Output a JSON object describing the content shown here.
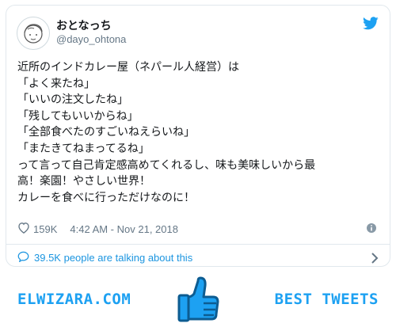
{
  "user": {
    "display_name": "おとなっち",
    "handle": "@dayo_ohtona"
  },
  "tweet": {
    "lines": [
      "近所のインドカレー屋（ネパール人経営）は",
      "「よく来たね」",
      "「いいの注文したね」",
      "「残してもいいからね」",
      "「全部食べたのすごいねえらいね」",
      "「またきてねまってるね」",
      "って言って自己肯定感高めてくれるし、味も美味しいから最",
      "高！楽園！やさしい世界！",
      "カレーを食べに行っただけなのに！"
    ]
  },
  "meta": {
    "likes": "159K",
    "timestamp": "4:42 AM - Nov 21, 2018"
  },
  "conversation": {
    "label": "39.5K people are talking about this"
  },
  "banner": {
    "left_text": "ELWIZARA.COM",
    "right_text": "BEST TWEETS"
  },
  "colors": {
    "accent": "#1da1f2",
    "link": "#1b95e0",
    "text": "#14171a",
    "muted": "#657786",
    "border": "#e1e8ed"
  },
  "icons": [
    "avatar-sketch",
    "twitter-bird-icon",
    "heart-icon",
    "info-icon",
    "speech-bubble-icon",
    "chevron-right-icon",
    "thumbs-up-icon"
  ]
}
